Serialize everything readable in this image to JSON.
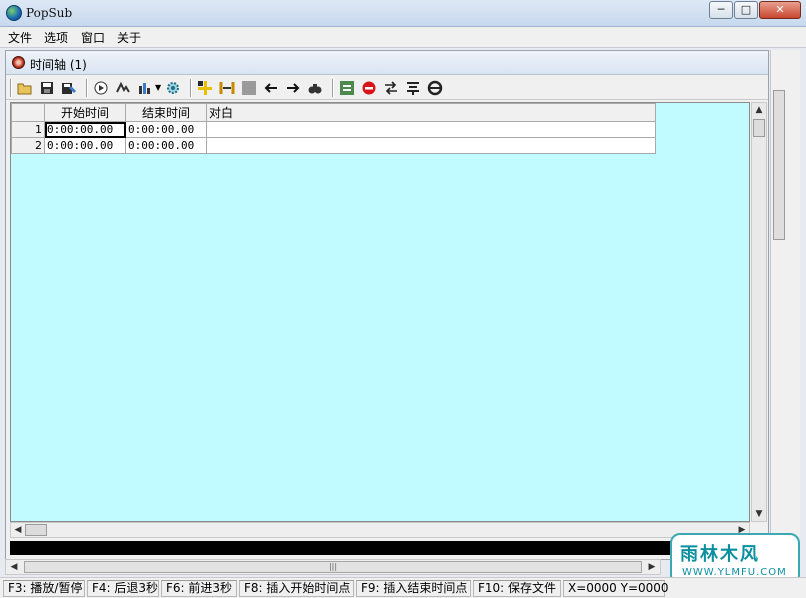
{
  "window": {
    "title": "PopSub",
    "min": "─",
    "max": "□",
    "close": "✕"
  },
  "menu": [
    "文件",
    "选项",
    "窗口",
    "关于"
  ],
  "child": {
    "title": "时间轴 (1)"
  },
  "toolbar": {
    "icons": [
      "open-icon",
      "save-icon",
      "save-as-icon",
      "video-icon",
      "audio-icon",
      "chart-icon",
      "settings-icon",
      "insert-icon",
      "split-icon",
      "stop-square-icon",
      "arrow-left-icon",
      "arrow-right-icon",
      "find-icon",
      "convert-icon",
      "delete-icon",
      "sync-icon",
      "merge-icon",
      "effects-icon"
    ]
  },
  "grid": {
    "columns": [
      "开始时间",
      "结束时间",
      "对白"
    ],
    "rows": [
      {
        "num": "1",
        "start": "0:00:00.00",
        "end": "0:00:00.00",
        "text": ""
      },
      {
        "num": "2",
        "start": "0:00:00.00",
        "end": "0:00:00.00",
        "text": ""
      }
    ]
  },
  "colors": {
    "grid_bg": "#c1fbff",
    "accent": "#3aa9b5"
  },
  "status": [
    "F3: 播放/暂停",
    "F4: 后退3秒",
    "F6: 前进3秒",
    "F8: 插入开始时间点",
    "F9: 插入结束时间点",
    "F10: 保存文件",
    "X=0000 Y=0000"
  ],
  "watermark": {
    "text": "雨林木风",
    "url": "WWW.YLMFU.COM"
  }
}
